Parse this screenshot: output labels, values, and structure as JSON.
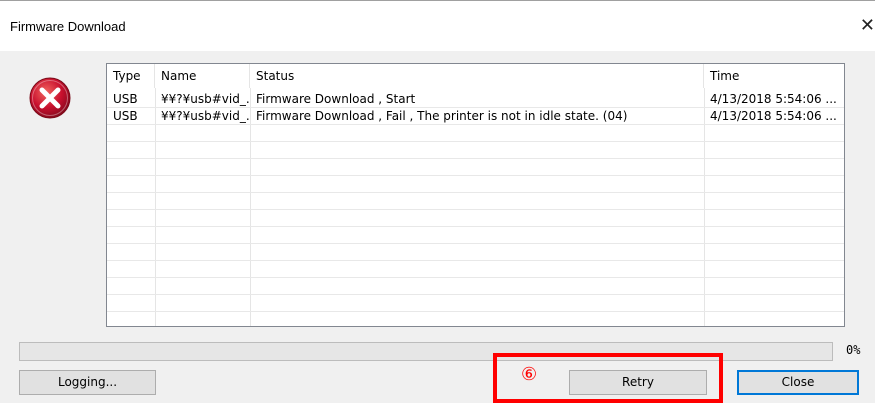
{
  "window": {
    "title": "Firmware Download",
    "close_glyph": "✕"
  },
  "icon": {
    "name": "error-icon",
    "color": "#c8102e"
  },
  "list": {
    "columns": [
      "Type",
      "Name",
      "Status",
      "Time"
    ],
    "rows": [
      {
        "type": "USB",
        "name": "¥¥?¥usb#vid_...",
        "status": "Firmware Download , Start",
        "time": "4/13/2018 5:54:06 ..."
      },
      {
        "type": "USB",
        "name": "¥¥?¥usb#vid_...",
        "status": "Firmware Download ,  Fail , The printer is not in idle state. (04)",
        "time": "4/13/2018 5:54:06 ..."
      }
    ]
  },
  "progress": {
    "value": 0,
    "label": "0%"
  },
  "buttons": {
    "logging": "Logging...",
    "retry": "Retry",
    "close": "Close"
  },
  "annotation": {
    "marker": "⑥",
    "color": "#ff0000"
  },
  "colors": {
    "accent": "#0078d7",
    "highlight": "#ff0000"
  }
}
